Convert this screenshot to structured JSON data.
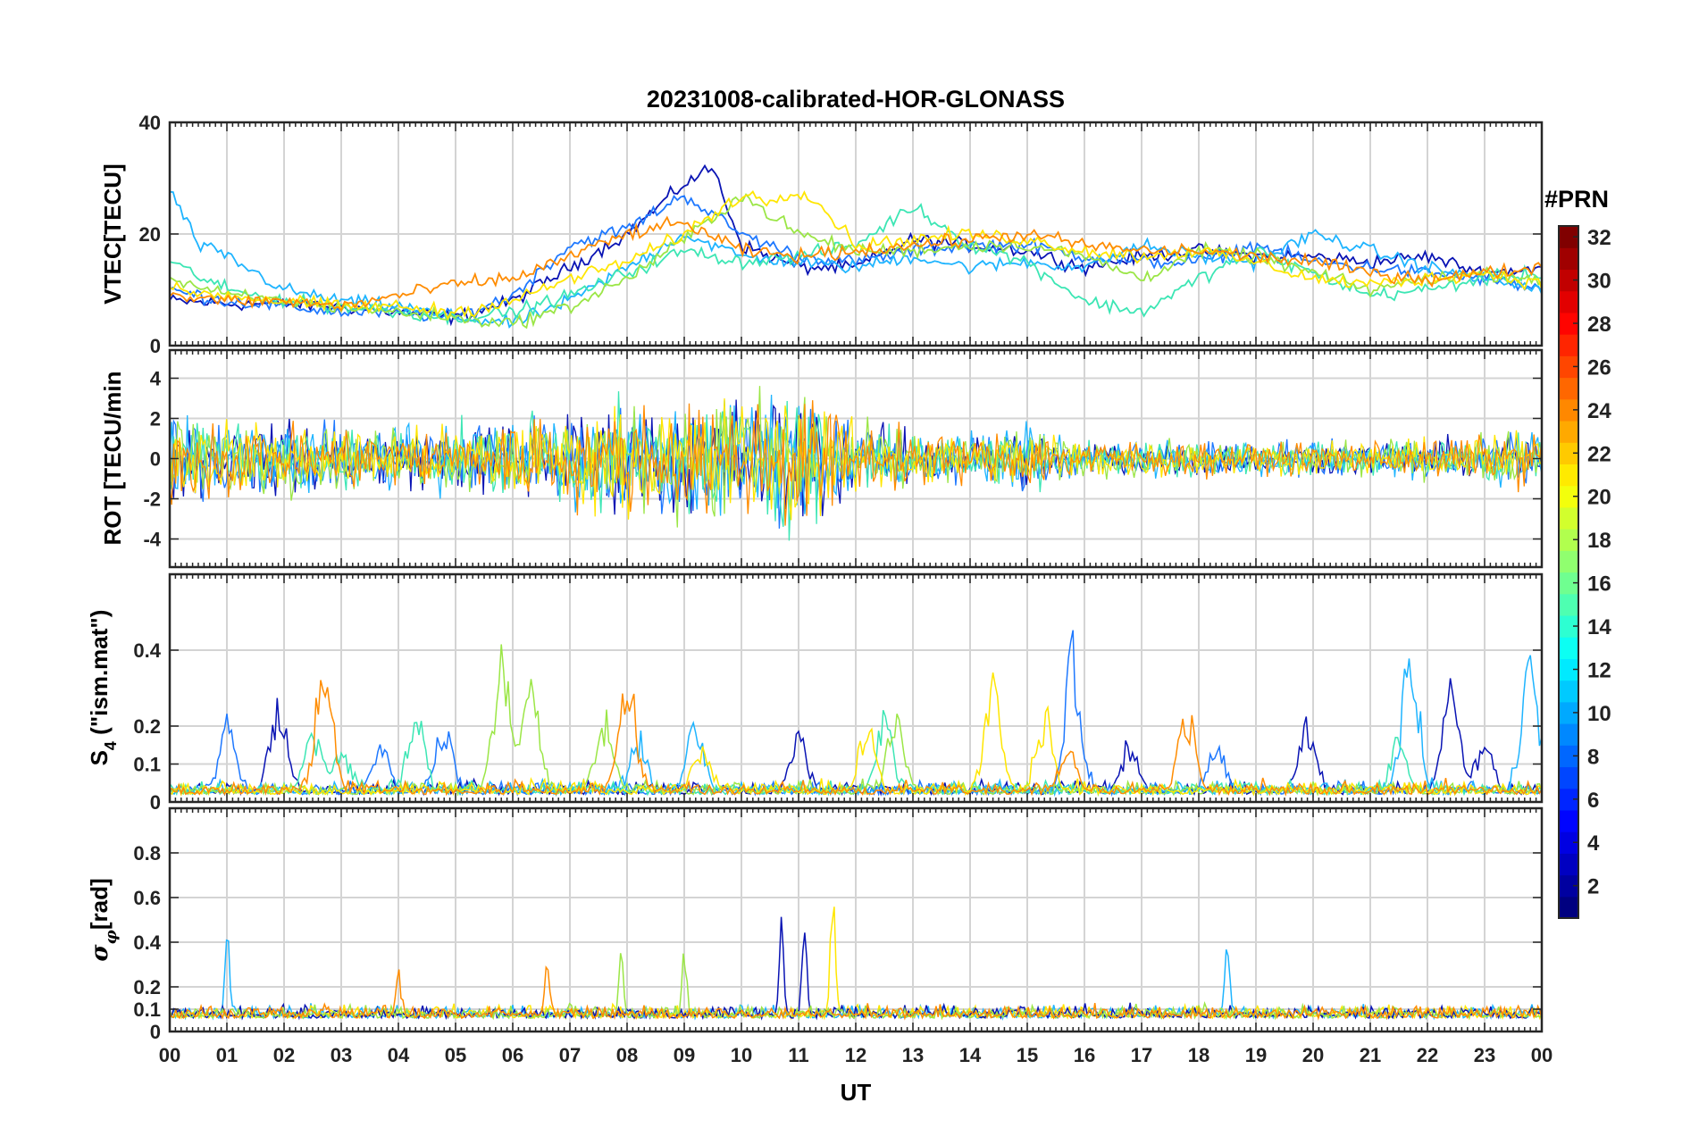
{
  "title": "20231008-calibrated-HOR-GLONASS",
  "chart_data": [
    {
      "type": "line",
      "panel": "VTEC",
      "ylabel": "VTEC[TECU]",
      "ylim": [
        0,
        40
      ],
      "yticks": [
        "40",
        "20",
        "0"
      ],
      "series": [
        {
          "color": "#0a14b4",
          "x": [
            0,
            1,
            2,
            3,
            4,
            5,
            6,
            7,
            8,
            9,
            9.5,
            10,
            11,
            12,
            13,
            14,
            15,
            16,
            17,
            18,
            19,
            20,
            21,
            22,
            23,
            24
          ],
          "y": [
            8,
            7.5,
            7.5,
            7,
            6,
            5,
            8,
            14,
            20,
            29,
            32,
            18,
            14,
            14,
            19,
            18,
            17,
            14,
            16,
            17,
            16,
            16,
            15,
            16,
            13,
            14
          ]
        },
        {
          "color": "#1e78ff",
          "x": [
            0,
            1,
            2,
            3,
            4,
            5,
            6,
            7,
            8,
            9,
            10,
            11,
            12,
            13,
            14,
            15,
            16,
            17,
            18,
            19,
            20,
            21,
            22,
            23,
            24
          ],
          "y": [
            10,
            8,
            7,
            6,
            6,
            5,
            9,
            18,
            21,
            27,
            20,
            16,
            15,
            17,
            18,
            18,
            16,
            15,
            15,
            18,
            15,
            14,
            13,
            12,
            10
          ]
        },
        {
          "color": "#1eb4ff",
          "x": [
            0,
            0.5,
            1,
            2,
            3,
            4,
            5,
            6,
            7,
            8,
            9,
            10,
            11,
            12,
            13,
            14,
            15,
            16,
            17,
            18,
            19,
            20,
            21,
            22,
            23,
            24
          ],
          "y": [
            28,
            18,
            16,
            10,
            8,
            7,
            5,
            4,
            8,
            14,
            20,
            16,
            15,
            14,
            16,
            14,
            15,
            14,
            18,
            16,
            15,
            20,
            17,
            14,
            12,
            10
          ]
        },
        {
          "color": "#3ce6b4",
          "x": [
            0,
            1,
            2,
            3,
            4,
            5,
            6,
            7,
            8,
            9,
            10,
            11,
            12,
            13,
            14,
            15,
            16,
            17,
            18,
            19,
            20,
            21,
            22,
            23,
            24
          ],
          "y": [
            15,
            10,
            8,
            7,
            6,
            5,
            6,
            9,
            13,
            17,
            15,
            16,
            18,
            25,
            18,
            15,
            8,
            6,
            12,
            17,
            13,
            9,
            10,
            12,
            13
          ]
        },
        {
          "color": "#9be646",
          "x": [
            0,
            1,
            2,
            3,
            4,
            5,
            6,
            7,
            8,
            9,
            10,
            11,
            12,
            13,
            14,
            15,
            16,
            17,
            18,
            19,
            20,
            21,
            22,
            23,
            24
          ],
          "y": [
            12,
            9,
            8,
            7,
            6,
            5,
            4,
            7,
            12,
            19,
            27,
            20,
            17,
            17,
            18,
            18,
            16,
            12,
            17,
            16,
            13,
            10,
            12,
            13,
            12
          ]
        },
        {
          "color": "#ffe600",
          "x": [
            0,
            1,
            2,
            3,
            4,
            5,
            6,
            7,
            8,
            9,
            10,
            10.5,
            11,
            11.5,
            12,
            13,
            14,
            15,
            16,
            17,
            18,
            19,
            20,
            21,
            22,
            23,
            24
          ],
          "y": [
            10,
            9,
            8,
            7,
            7,
            6,
            8,
            12,
            15,
            20,
            27,
            26,
            28,
            24,
            18,
            19,
            20,
            19,
            17,
            16,
            17,
            15,
            12,
            11,
            12,
            13,
            11
          ]
        },
        {
          "color": "#ff8c00",
          "x": [
            0,
            1,
            2,
            3,
            4,
            5,
            6,
            7,
            8,
            9,
            10,
            11,
            12,
            13,
            14,
            15,
            16,
            17,
            18,
            19,
            20,
            21,
            22,
            23,
            24
          ],
          "y": [
            9,
            8,
            8,
            7,
            9,
            11,
            12,
            16,
            20,
            22,
            17,
            16,
            17,
            18,
            19,
            20,
            18,
            17,
            17,
            16,
            15,
            13,
            12,
            13,
            14
          ]
        }
      ]
    },
    {
      "type": "line",
      "panel": "ROT",
      "ylabel": "ROT [TECU/min",
      "ylim": [
        -5.4,
        5.4
      ],
      "yticks": [
        "4",
        "2",
        "0",
        "-2",
        "-4"
      ],
      "noise_envelope": {
        "x": [
          0,
          3,
          5,
          6,
          7,
          8,
          9,
          10,
          11,
          11.5,
          12,
          14,
          15,
          16,
          18,
          19,
          20,
          21,
          22,
          23,
          24
        ],
        "amp": [
          2.2,
          1.6,
          1.6,
          2.2,
          2.4,
          2.6,
          2.8,
          3.2,
          3.6,
          3.0,
          1.8,
          1.2,
          1.6,
          1.0,
          0.9,
          0.8,
          0.8,
          0.9,
          1.0,
          1.2,
          1.4
        ]
      },
      "series_colors": [
        "#0a14b4",
        "#1e78ff",
        "#1eb4ff",
        "#3ce6b4",
        "#9be646",
        "#ffe600",
        "#ff8c00"
      ]
    },
    {
      "type": "line",
      "panel": "S4",
      "ylabel": "S4 (\"ism.mat\")",
      "ylim": [
        0,
        0.6
      ],
      "yticks": [
        "0.4",
        "0.2",
        "0.1",
        "0"
      ],
      "baseline": 0.02,
      "bursts": [
        {
          "color": "#0a14b4",
          "x": [
            1.9,
            11.0,
            16.8,
            19.9,
            22.4,
            23.0
          ],
          "h": [
            0.25,
            0.15,
            0.12,
            0.18,
            0.3,
            0.12
          ]
        },
        {
          "color": "#1e78ff",
          "x": [
            1.0,
            3.7,
            4.8,
            15.8,
            18.3
          ],
          "h": [
            0.18,
            0.12,
            0.18,
            0.38,
            0.12
          ]
        },
        {
          "color": "#1eb4ff",
          "x": [
            9.2,
            8.2,
            21.7,
            23.8
          ],
          "h": [
            0.2,
            0.13,
            0.38,
            0.38
          ]
        },
        {
          "color": "#3ce6b4",
          "x": [
            2.5,
            3.0,
            4.3,
            12.5,
            21.5
          ],
          "h": [
            0.16,
            0.12,
            0.22,
            0.2,
            0.15
          ]
        },
        {
          "color": "#9be646",
          "x": [
            5.8,
            6.3,
            7.6,
            12.7
          ],
          "h": [
            0.37,
            0.3,
            0.2,
            0.22
          ]
        },
        {
          "color": "#ffe600",
          "x": [
            9.3,
            12.2,
            14.4,
            15.3
          ],
          "h": [
            0.12,
            0.17,
            0.3,
            0.2
          ]
        },
        {
          "color": "#ff8c00",
          "x": [
            2.7,
            8.0,
            15.7,
            17.8
          ],
          "h": [
            0.37,
            0.3,
            0.12,
            0.22
          ]
        }
      ]
    },
    {
      "type": "line",
      "panel": "SigmaPhi",
      "ylabel": "σφ[rad]",
      "ylim": [
        0,
        1.0
      ],
      "yticks": [
        "0.8",
        "0.6",
        "0.4",
        "0.2",
        "0.1",
        "0"
      ],
      "baseline": 0.06,
      "spikes": [
        {
          "color": "#1eb4ff",
          "x": [
            1.0,
            18.5
          ],
          "h": [
            0.4,
            0.36
          ]
        },
        {
          "color": "#ffe600",
          "x": [
            11.6
          ],
          "h": [
            0.6
          ]
        },
        {
          "color": "#0a14b4",
          "x": [
            11.1,
            10.7
          ],
          "h": [
            0.52,
            0.42
          ]
        },
        {
          "color": "#9be646",
          "x": [
            9.0,
            7.9
          ],
          "h": [
            0.33,
            0.3
          ]
        },
        {
          "color": "#ff8c00",
          "x": [
            6.6,
            4.0
          ],
          "h": [
            0.27,
            0.22
          ]
        }
      ]
    }
  ],
  "x_axis": {
    "label": "UT",
    "ticks": [
      "00",
      "01",
      "02",
      "03",
      "04",
      "05",
      "06",
      "07",
      "08",
      "09",
      "10",
      "11",
      "12",
      "13",
      "14",
      "15",
      "16",
      "17",
      "18",
      "19",
      "20",
      "21",
      "22",
      "23",
      "00"
    ],
    "range": [
      0,
      24
    ]
  },
  "colorbar": {
    "title": "#PRN",
    "range": [
      1,
      32
    ],
    "ticks": [
      "32",
      "30",
      "28",
      "26",
      "24",
      "22",
      "20",
      "18",
      "16",
      "14",
      "12",
      "10",
      "8",
      "6",
      "4",
      "2"
    ],
    "colormap": "jet"
  }
}
